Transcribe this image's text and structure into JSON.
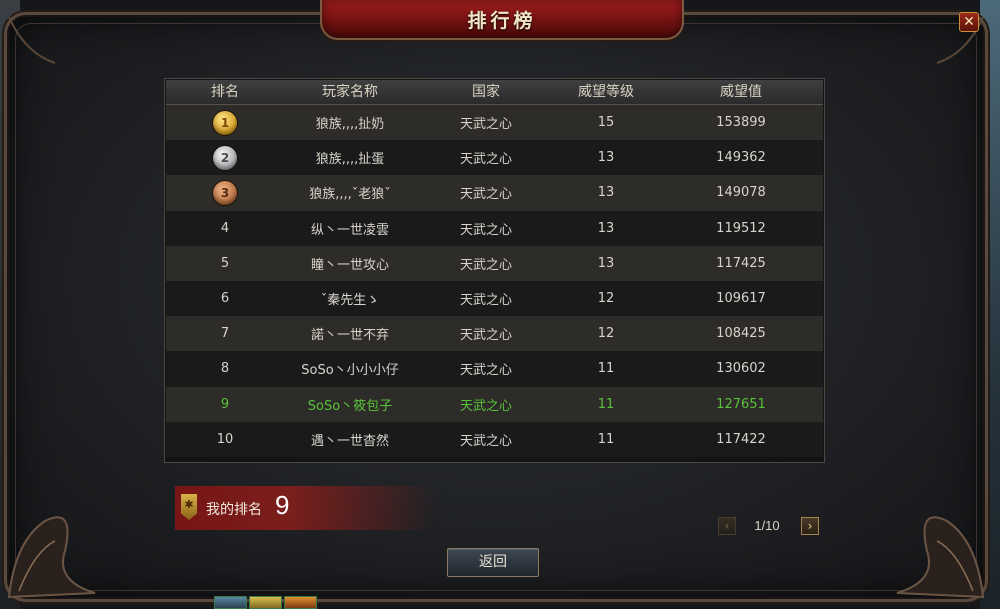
{
  "window": {
    "title": "排行榜",
    "close_symbol": "✕"
  },
  "table": {
    "headers": [
      "排名",
      "玩家名称",
      "国家",
      "威望等级",
      "威望值"
    ],
    "rows": [
      {
        "rank": "1",
        "medal": "gold",
        "name": "狼族,,,,扯奶",
        "country": "天武之心",
        "level": "15",
        "value": "153899"
      },
      {
        "rank": "2",
        "medal": "silver",
        "name": "狼族,,,,扯蛋",
        "country": "天武之心",
        "level": "13",
        "value": "149362"
      },
      {
        "rank": "3",
        "medal": "bronze",
        "name": "狼族,,,,ˇ老狼ˇ",
        "country": "天武之心",
        "level": "13",
        "value": "149078"
      },
      {
        "rank": "4",
        "medal": "",
        "name": "纵丶一世凌雲",
        "country": "天武之心",
        "level": "13",
        "value": "119512"
      },
      {
        "rank": "5",
        "medal": "",
        "name": "瞳丶一世攻心",
        "country": "天武之心",
        "level": "13",
        "value": "117425"
      },
      {
        "rank": "6",
        "medal": "",
        "name": "ˇ秦先生ゝ",
        "country": "天武之心",
        "level": "12",
        "value": "109617"
      },
      {
        "rank": "7",
        "medal": "",
        "name": "諾丶一世不弃",
        "country": "天武之心",
        "level": "12",
        "value": "108425"
      },
      {
        "rank": "8",
        "medal": "",
        "name": "SoSo丶小小小仔",
        "country": "天武之心",
        "level": "11",
        "value": "130602"
      },
      {
        "rank": "9",
        "medal": "",
        "name": "SoSo丶筱包子",
        "country": "天武之心",
        "level": "11",
        "value": "127651",
        "is_me": true
      },
      {
        "rank": "10",
        "medal": "",
        "name": "遇丶一世杳然",
        "country": "天武之心",
        "level": "11",
        "value": "117422"
      }
    ]
  },
  "my_rank": {
    "label": "我的排名",
    "value": "9",
    "icon": "rank-shield-icon"
  },
  "pager": {
    "text": "1/10",
    "prev_symbol": "‹",
    "next_symbol": "›"
  },
  "back_button": {
    "label": "返回"
  },
  "colors": {
    "highlight_row": "#58c23a",
    "title_plate": "#8a1616",
    "gold": "#d29a1e",
    "silver": "#a9aaad",
    "bronze": "#b46a3b"
  }
}
